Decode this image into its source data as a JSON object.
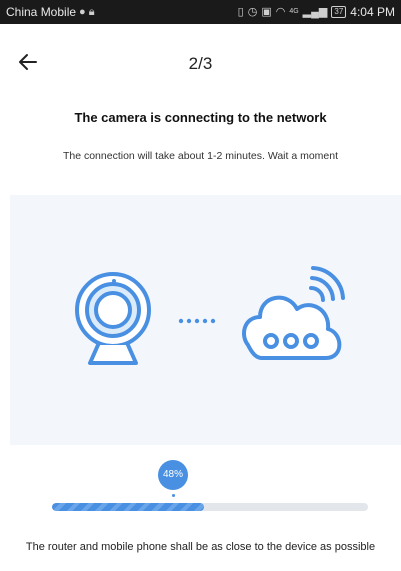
{
  "status_bar": {
    "carrier": "China Mobile",
    "network": "4G",
    "battery": "37",
    "time": "4:04 PM",
    "icons": [
      "wechat-icon",
      "lock-icon",
      "vibrate-icon",
      "alarm-icon",
      "photo-icon",
      "wifi-icon",
      "signal-icon",
      "battery-icon"
    ]
  },
  "header": {
    "step": "2/3",
    "back_icon": "arrow-left-icon"
  },
  "content": {
    "title": "The camera is connecting to the network",
    "subtitle": "The connection will take about 1-2 minutes. Wait a moment"
  },
  "illustration": {
    "left_icon": "camera-icon",
    "middle_icon": "dots-icon",
    "right_icon": "cloud-icon",
    "accent_color": "#4a90e2",
    "background_color": "#f3f7fc"
  },
  "progress": {
    "value": 48,
    "label": "48%"
  },
  "footer": {
    "hint": "The router and mobile phone shall be as close to the device as possible"
  }
}
